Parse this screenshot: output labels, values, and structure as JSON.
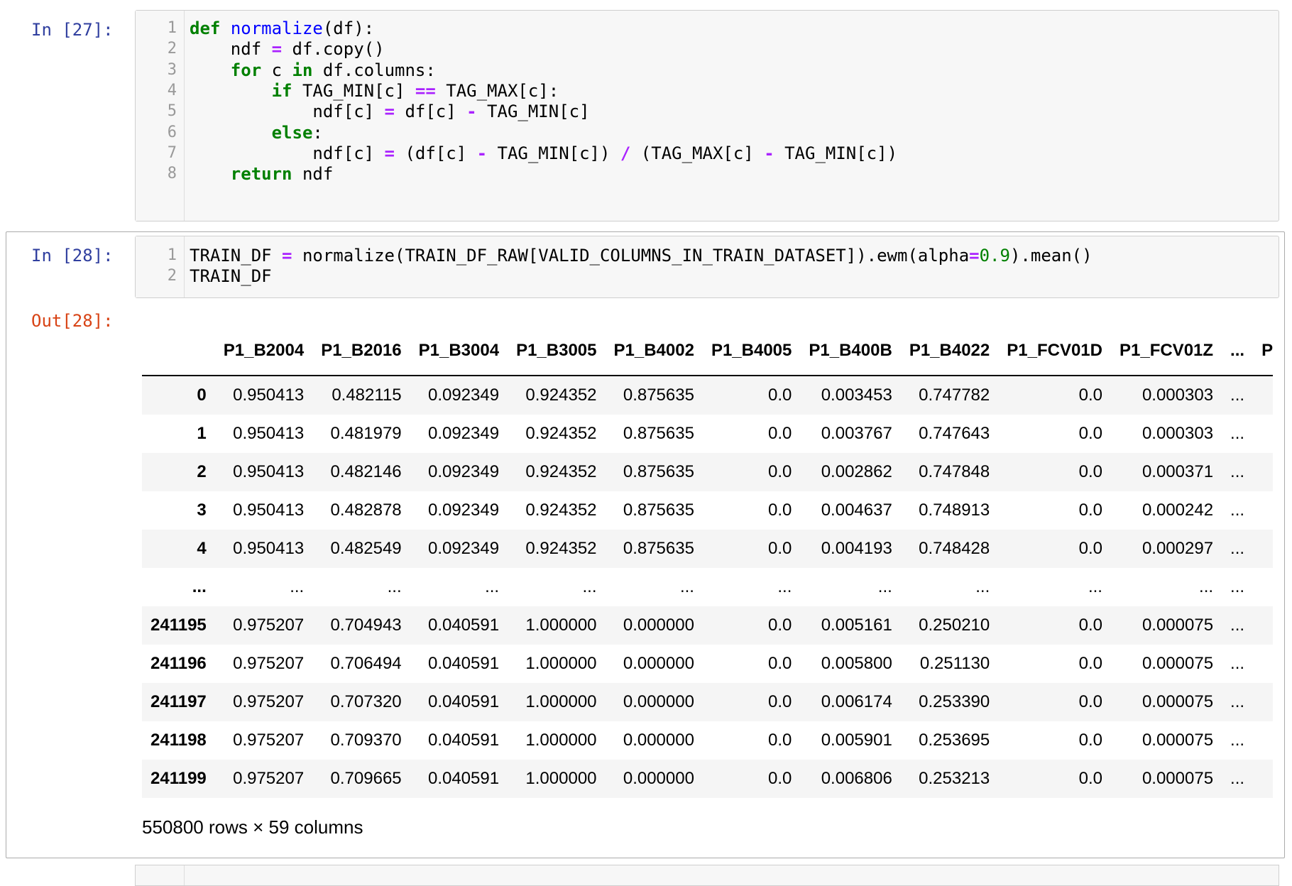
{
  "cell27": {
    "prompt": "In [27]:",
    "lines": [
      "1",
      "2",
      "3",
      "4",
      "5",
      "6",
      "7",
      "8"
    ],
    "code": [
      [
        [
          "kw",
          "def"
        ],
        [
          "tx",
          " "
        ],
        [
          "fn",
          "normalize"
        ],
        [
          "tx",
          "(df):"
        ]
      ],
      [
        [
          "tx",
          "    ndf "
        ],
        [
          "op",
          "="
        ],
        [
          "tx",
          " df.copy()"
        ]
      ],
      [
        [
          "tx",
          "    "
        ],
        [
          "kw",
          "for"
        ],
        [
          "tx",
          " c "
        ],
        [
          "kw",
          "in"
        ],
        [
          "tx",
          " df.columns:"
        ]
      ],
      [
        [
          "tx",
          "        "
        ],
        [
          "kw",
          "if"
        ],
        [
          "tx",
          " TAG_MIN[c] "
        ],
        [
          "op",
          "=="
        ],
        [
          "tx",
          " TAG_MAX[c]:"
        ]
      ],
      [
        [
          "tx",
          "            ndf[c] "
        ],
        [
          "op",
          "="
        ],
        [
          "tx",
          " df[c] "
        ],
        [
          "op",
          "-"
        ],
        [
          "tx",
          " TAG_MIN[c]"
        ]
      ],
      [
        [
          "tx",
          "        "
        ],
        [
          "kw",
          "else"
        ],
        [
          "tx",
          ":"
        ]
      ],
      [
        [
          "tx",
          "            ndf[c] "
        ],
        [
          "op",
          "="
        ],
        [
          "tx",
          " (df[c] "
        ],
        [
          "op",
          "-"
        ],
        [
          "tx",
          " TAG_MIN[c]) "
        ],
        [
          "op",
          "/"
        ],
        [
          "tx",
          " (TAG_MAX[c] "
        ],
        [
          "op",
          "-"
        ],
        [
          "tx",
          " TAG_MIN[c])"
        ]
      ],
      [
        [
          "tx",
          "    "
        ],
        [
          "kw",
          "return"
        ],
        [
          "tx",
          " ndf"
        ]
      ]
    ]
  },
  "cell28": {
    "prompt": "In [28]:",
    "out_prompt": "Out[28]:",
    "lines": [
      "1",
      "2"
    ],
    "code": [
      [
        [
          "tx",
          "TRAIN_DF "
        ],
        [
          "op",
          "="
        ],
        [
          "tx",
          " normalize(TRAIN_DF_RAW[VALID_COLUMNS_IN_TRAIN_DATASET]).ewm(alpha"
        ],
        [
          "op",
          "="
        ],
        [
          "num",
          "0.9"
        ],
        [
          "tx",
          ").mean()"
        ]
      ],
      [
        [
          "tx",
          "TRAIN_DF"
        ]
      ]
    ]
  },
  "table": {
    "columns": [
      "",
      "P1_B2004",
      "P1_B2016",
      "P1_B3004",
      "P1_B3005",
      "P1_B4002",
      "P1_B4005",
      "P1_B400B",
      "P1_B4022",
      "P1_FCV01D",
      "P1_FCV01Z",
      "...",
      "P"
    ],
    "rows": [
      [
        "0",
        "0.950413",
        "0.482115",
        "0.092349",
        "0.924352",
        "0.875635",
        "0.0",
        "0.003453",
        "0.747782",
        "0.0",
        "0.000303",
        "..."
      ],
      [
        "1",
        "0.950413",
        "0.481979",
        "0.092349",
        "0.924352",
        "0.875635",
        "0.0",
        "0.003767",
        "0.747643",
        "0.0",
        "0.000303",
        "..."
      ],
      [
        "2",
        "0.950413",
        "0.482146",
        "0.092349",
        "0.924352",
        "0.875635",
        "0.0",
        "0.002862",
        "0.747848",
        "0.0",
        "0.000371",
        "..."
      ],
      [
        "3",
        "0.950413",
        "0.482878",
        "0.092349",
        "0.924352",
        "0.875635",
        "0.0",
        "0.004637",
        "0.748913",
        "0.0",
        "0.000242",
        "..."
      ],
      [
        "4",
        "0.950413",
        "0.482549",
        "0.092349",
        "0.924352",
        "0.875635",
        "0.0",
        "0.004193",
        "0.748428",
        "0.0",
        "0.000297",
        "..."
      ],
      [
        "...",
        "...",
        "...",
        "...",
        "...",
        "...",
        "...",
        "...",
        "...",
        "...",
        "...",
        "..."
      ],
      [
        "241195",
        "0.975207",
        "0.704943",
        "0.040591",
        "1.000000",
        "0.000000",
        "0.0",
        "0.005161",
        "0.250210",
        "0.0",
        "0.000075",
        "..."
      ],
      [
        "241196",
        "0.975207",
        "0.706494",
        "0.040591",
        "1.000000",
        "0.000000",
        "0.0",
        "0.005800",
        "0.251130",
        "0.0",
        "0.000075",
        "..."
      ],
      [
        "241197",
        "0.975207",
        "0.707320",
        "0.040591",
        "1.000000",
        "0.000000",
        "0.0",
        "0.006174",
        "0.253390",
        "0.0",
        "0.000075",
        "..."
      ],
      [
        "241198",
        "0.975207",
        "0.709370",
        "0.040591",
        "1.000000",
        "0.000000",
        "0.0",
        "0.005901",
        "0.253695",
        "0.0",
        "0.000075",
        "..."
      ],
      [
        "241199",
        "0.975207",
        "0.709665",
        "0.040591",
        "1.000000",
        "0.000000",
        "0.0",
        "0.006806",
        "0.253213",
        "0.0",
        "0.000075",
        "..."
      ]
    ],
    "summary": "550800 rows × 59 columns"
  }
}
